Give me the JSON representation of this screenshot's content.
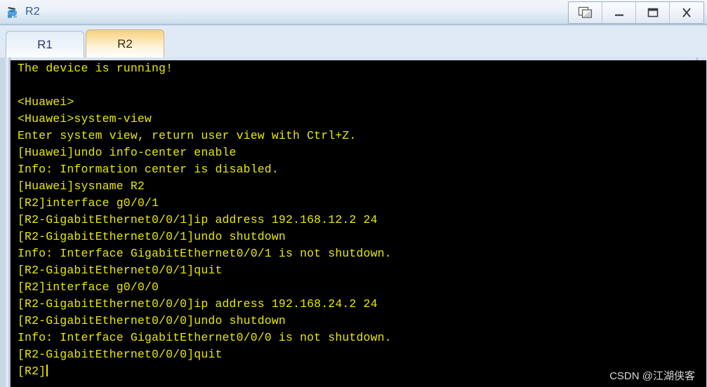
{
  "window": {
    "title": "R2",
    "icon": "router-device-icon",
    "buttons": [
      {
        "name": "restore-windows-button",
        "icon": "cascade-windows-icon",
        "label": ""
      },
      {
        "name": "minimize-button",
        "icon": "minimize-icon",
        "label": ""
      },
      {
        "name": "maximize-button",
        "icon": "maximize-icon",
        "label": ""
      },
      {
        "name": "close-button",
        "icon": "close-icon",
        "label": "X"
      }
    ]
  },
  "tabs": {
    "items": [
      {
        "label": "R1",
        "active": false
      },
      {
        "label": "R2",
        "active": true
      }
    ]
  },
  "terminal": {
    "foreground": "#e8e800",
    "background": "#000000",
    "prompt_cursor": true,
    "lines": [
      "The device is running!",
      "",
      "<Huawei>",
      "<Huawei>system-view",
      "Enter system view, return user view with Ctrl+Z.",
      "[Huawei]undo info-center enable",
      "Info: Information center is disabled.",
      "[Huawei]sysname R2",
      "[R2]interface g0/0/1",
      "[R2-GigabitEthernet0/0/1]ip address 192.168.12.2 24",
      "[R2-GigabitEthernet0/0/1]undo shutdown",
      "Info: Interface GigabitEthernet0/0/1 is not shutdown.",
      "[R2-GigabitEthernet0/0/1]quit",
      "[R2]interface g0/0/0",
      "[R2-GigabitEthernet0/0/0]ip address 192.168.24.2 24",
      "[R2-GigabitEthernet0/0/0]undo shutdown",
      "Info: Interface GigabitEthernet0/0/0 is not shutdown.",
      "[R2-GigabitEthernet0/0/0]quit"
    ],
    "last_line": "[R2]"
  },
  "watermark": {
    "text": "CSDN @江湖侠客"
  }
}
